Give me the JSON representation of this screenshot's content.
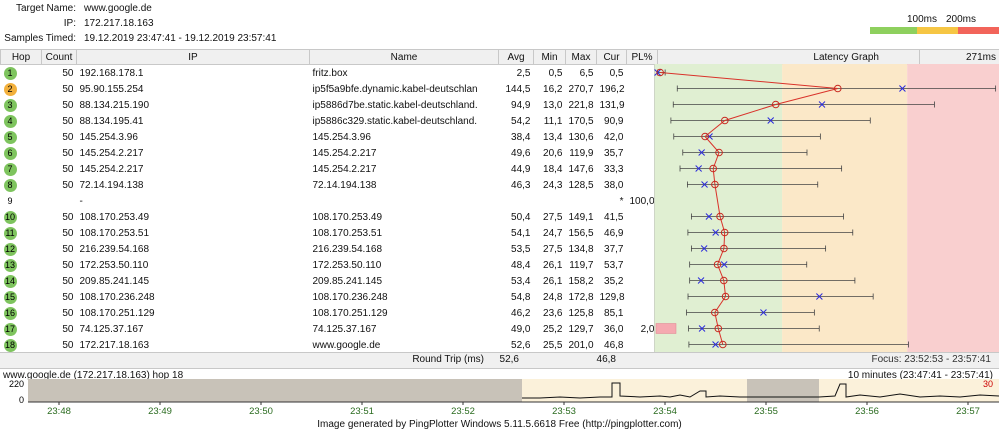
{
  "header": {
    "target_label": "Target Name:",
    "target_value": "www.google.de",
    "ip_label": "IP:",
    "ip_value": "172.217.18.163",
    "samples_label": "Samples Timed:",
    "samples_value": "19.12.2019 23:47:41 - 19.12.2019 23:57:41",
    "scale_100": "100ms",
    "scale_200": "200ms",
    "colors": {
      "good": "#8ed05e",
      "warn": "#f6c644",
      "bad": "#f2645a"
    }
  },
  "table": {
    "columns": [
      "Hop",
      "Count",
      "IP",
      "Name",
      "Avg",
      "Min",
      "Max",
      "Cur",
      "PL%",
      "Latency Graph",
      "271ms"
    ],
    "max_ms": 271,
    "rows": [
      {
        "hop": "1",
        "status": "g",
        "count": "50",
        "ip": "192.168.178.1",
        "name": "fritz.box",
        "avg": "2,5",
        "min": "0,5",
        "max": "6,5",
        "cur": "0,5",
        "pl": "",
        "pl_mark": "",
        "avg_ms": 2.5,
        "min_ms": 0.5,
        "max_ms": 6.5,
        "cur_ms": 0.5
      },
      {
        "hop": "2",
        "status": "o",
        "count": "50",
        "ip": "95.90.155.254",
        "name": "ip5f5a9bfe.dynamic.kabel-deutschlan",
        "avg": "144,5",
        "min": "16,2",
        "max": "270,7",
        "cur": "196,2",
        "pl": "",
        "pl_mark": "",
        "avg_ms": 144.5,
        "min_ms": 16.2,
        "max_ms": 270.7,
        "cur_ms": 196.2
      },
      {
        "hop": "3",
        "status": "g",
        "count": "50",
        "ip": "88.134.215.190",
        "name": "ip5886d7be.static.kabel-deutschland.",
        "avg": "94,9",
        "min": "13,0",
        "max": "221,8",
        "cur": "131,9",
        "pl": "",
        "pl_mark": "",
        "avg_ms": 94.9,
        "min_ms": 13.0,
        "max_ms": 221.8,
        "cur_ms": 131.9
      },
      {
        "hop": "4",
        "status": "g",
        "count": "50",
        "ip": "88.134.195.41",
        "name": "ip5886c329.static.kabel-deutschland.",
        "avg": "54,2",
        "min": "11,1",
        "max": "170,5",
        "cur": "90,9",
        "pl": "",
        "pl_mark": "",
        "avg_ms": 54.2,
        "min_ms": 11.1,
        "max_ms": 170.5,
        "cur_ms": 90.9
      },
      {
        "hop": "5",
        "status": "g",
        "count": "50",
        "ip": "145.254.3.96",
        "name": "145.254.3.96",
        "avg": "38,4",
        "min": "13,4",
        "max": "130,6",
        "cur": "42,0",
        "pl": "",
        "pl_mark": "",
        "avg_ms": 38.4,
        "min_ms": 13.4,
        "max_ms": 130.6,
        "cur_ms": 42.0
      },
      {
        "hop": "6",
        "status": "g",
        "count": "50",
        "ip": "145.254.2.217",
        "name": "145.254.2.217",
        "avg": "49,6",
        "min": "20,6",
        "max": "119,9",
        "cur": "35,7",
        "pl": "",
        "pl_mark": "",
        "avg_ms": 49.6,
        "min_ms": 20.6,
        "max_ms": 119.9,
        "cur_ms": 35.7
      },
      {
        "hop": "7",
        "status": "g",
        "count": "50",
        "ip": "145.254.2.217",
        "name": "145.254.2.217",
        "avg": "44,9",
        "min": "18,4",
        "max": "147,6",
        "cur": "33,3",
        "pl": "",
        "pl_mark": "",
        "avg_ms": 44.9,
        "min_ms": 18.4,
        "max_ms": 147.6,
        "cur_ms": 33.3
      },
      {
        "hop": "8",
        "status": "g",
        "count": "50",
        "ip": "72.14.194.138",
        "name": "72.14.194.138",
        "avg": "46,3",
        "min": "24,3",
        "max": "128,5",
        "cur": "38,0",
        "pl": "",
        "pl_mark": "",
        "avg_ms": 46.3,
        "min_ms": 24.3,
        "max_ms": 128.5,
        "cur_ms": 38.0
      },
      {
        "hop": "9",
        "status": "n",
        "count": "",
        "ip": "-",
        "name": "",
        "avg": "",
        "min": "",
        "max": "",
        "cur": "*",
        "pl": "100,0",
        "pl_mark": "",
        "avg_ms": null,
        "min_ms": null,
        "max_ms": null,
        "cur_ms": null
      },
      {
        "hop": "10",
        "status": "g",
        "count": "50",
        "ip": "108.170.253.49",
        "name": "108.170.253.49",
        "avg": "50,4",
        "min": "27,5",
        "max": "149,1",
        "cur": "41,5",
        "pl": "",
        "pl_mark": "",
        "avg_ms": 50.4,
        "min_ms": 27.5,
        "max_ms": 149.1,
        "cur_ms": 41.5
      },
      {
        "hop": "11",
        "status": "g",
        "count": "50",
        "ip": "108.170.253.51",
        "name": "108.170.253.51",
        "avg": "54,1",
        "min": "24,7",
        "max": "156,5",
        "cur": "46,9",
        "pl": "",
        "pl_mark": "",
        "avg_ms": 54.1,
        "min_ms": 24.7,
        "max_ms": 156.5,
        "cur_ms": 46.9
      },
      {
        "hop": "12",
        "status": "g",
        "count": "50",
        "ip": "216.239.54.168",
        "name": "216.239.54.168",
        "avg": "53,5",
        "min": "27,5",
        "max": "134,8",
        "cur": "37,7",
        "pl": "",
        "pl_mark": "",
        "avg_ms": 53.5,
        "min_ms": 27.5,
        "max_ms": 134.8,
        "cur_ms": 37.7
      },
      {
        "hop": "13",
        "status": "g",
        "count": "50",
        "ip": "172.253.50.110",
        "name": "172.253.50.110",
        "avg": "48,4",
        "min": "26,1",
        "max": "119,7",
        "cur": "53,7",
        "pl": "",
        "pl_mark": "",
        "avg_ms": 48.4,
        "min_ms": 26.1,
        "max_ms": 119.7,
        "cur_ms": 53.7
      },
      {
        "hop": "14",
        "status": "g",
        "count": "50",
        "ip": "209.85.241.145",
        "name": "209.85.241.145",
        "avg": "53,4",
        "min": "26,1",
        "max": "158,2",
        "cur": "35,2",
        "pl": "",
        "pl_mark": "",
        "avg_ms": 53.4,
        "min_ms": 26.1,
        "max_ms": 158.2,
        "cur_ms": 35.2
      },
      {
        "hop": "15",
        "status": "g",
        "count": "50",
        "ip": "108.170.236.248",
        "name": "108.170.236.248",
        "avg": "54,8",
        "min": "24,8",
        "max": "172,8",
        "cur": "129,8",
        "pl": "",
        "pl_mark": "",
        "avg_ms": 54.8,
        "min_ms": 24.8,
        "max_ms": 172.8,
        "cur_ms": 129.8
      },
      {
        "hop": "16",
        "status": "g",
        "count": "50",
        "ip": "108.170.251.129",
        "name": "108.170.251.129",
        "avg": "46,2",
        "min": "23,6",
        "max": "125,8",
        "cur": "85,1",
        "pl": "",
        "pl_mark": "",
        "avg_ms": 46.2,
        "min_ms": 23.6,
        "max_ms": 125.8,
        "cur_ms": 85.1
      },
      {
        "hop": "17",
        "status": "g",
        "count": "50",
        "ip": "74.125.37.167",
        "name": "74.125.37.167",
        "avg": "49,0",
        "min": "25,2",
        "max": "129,7",
        "cur": "36,0",
        "pl": "2,0",
        "pl_mark": "pink",
        "avg_ms": 49.0,
        "min_ms": 25.2,
        "max_ms": 129.7,
        "cur_ms": 36.0
      },
      {
        "hop": "18",
        "status": "g",
        "count": "50",
        "ip": "172.217.18.163",
        "name": "www.google.de",
        "avg": "52,6",
        "min": "25,5",
        "max": "201,0",
        "cur": "46,8",
        "pl": "",
        "pl_mark": "",
        "avg_ms": 52.6,
        "min_ms": 25.5,
        "max_ms": 201.0,
        "cur_ms": 46.8
      }
    ]
  },
  "round_trip": {
    "label": "Round Trip (ms)",
    "avg": "52,6",
    "cur": "46,8",
    "focus": "Focus: 23:52:53 - 23:57:41"
  },
  "history": {
    "title_left": "www.google.de (172.217.18.163) hop 18",
    "title_right": "10 minutes (23:47:41 - 23:57:41)",
    "y_top": "220",
    "y_bottom": "0",
    "loss_label": "30",
    "time_labels": [
      "23:48",
      "23:49",
      "23:50",
      "23:51",
      "23:52",
      "23:53",
      "23:54",
      "23:55",
      "23:56",
      "23:57"
    ]
  },
  "footer": "Image generated by PingPlotter Windows 5.11.5.6618 Free (http://pingplotter.com)"
}
